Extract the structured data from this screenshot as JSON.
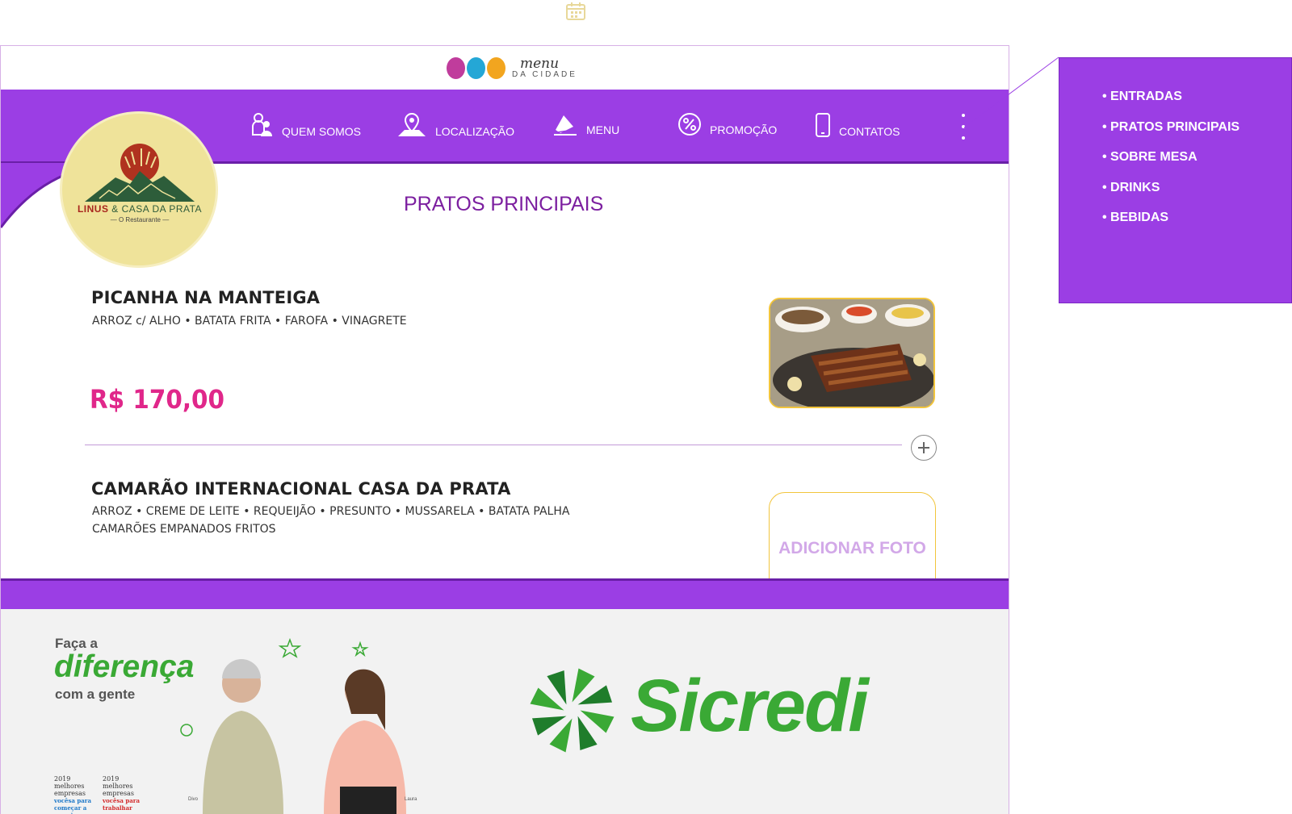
{
  "brand": {
    "line1": "menu",
    "line2": "DA CIDADE",
    "dot_colors": [
      "#c03c9c",
      "#24a7d6",
      "#f2a51f"
    ]
  },
  "nav": {
    "items": [
      {
        "label": "QUEM SOMOS",
        "icon": "people-icon"
      },
      {
        "label": "LOCALIZAÇÃO",
        "icon": "location-pin-icon"
      },
      {
        "label": "MENU",
        "icon": "menu-book-icon"
      },
      {
        "label": "PROMOÇÃO",
        "icon": "percent-icon"
      },
      {
        "label": "CONTATOS",
        "icon": "phone-icon"
      }
    ],
    "more_icon": "vertical-dots-icon"
  },
  "restaurant": {
    "name_part1": "LINUS",
    "amp": " & ",
    "name_part2": "CASA DA PRATA",
    "subtitle": "— O Restaurante —"
  },
  "section_title": "PRATOS PRINCIPAIS",
  "dishes": [
    {
      "name": "PICANHA NA MANTEIGA",
      "description": "ARROZ c/ ALHO • BATATA FRITA • FAROFA • VINAGRETE",
      "price": "R$ 170,00"
    },
    {
      "name": "CAMARÃO INTERNACIONAL CASA DA PRATA",
      "description_lines": [
        "ARROZ • CREME DE LEITE • REQUEIJÃO • PRESUNTO • MUSSARELA • BATATA PALHA",
        "CAMARÕES EMPANADOS FRITOS"
      ],
      "add_photo_label": "ADICIONAR FOTO"
    }
  ],
  "ad": {
    "line1": "Faça a",
    "line2": "diferença",
    "line3": "com a gente",
    "wordmark": "Sicredi",
    "awards": [
      {
        "year": "2019",
        "title": "melhores empresas",
        "brand": "vocêsa",
        "tag": "para começar a carreira"
      },
      {
        "year": "2019",
        "title": "melhores empresas",
        "brand": "vocêsa",
        "tag": "para trabalhar"
      }
    ],
    "captions": [
      "Divo",
      "Laura"
    ],
    "colors": {
      "green": "#3aa935",
      "dark_green": "#1f7d2b"
    }
  },
  "dropdown": {
    "items": [
      "• ENTRADAS",
      "• PRATOS PRINCIPAIS",
      "• SOBRE MESA",
      "• DRINKS",
      "• BEBIDAS"
    ]
  },
  "colors": {
    "purple": "#9b3ee4",
    "price": "#e0278a",
    "title": "#7c1fa0",
    "accent_yellow": "#f2c53d"
  }
}
